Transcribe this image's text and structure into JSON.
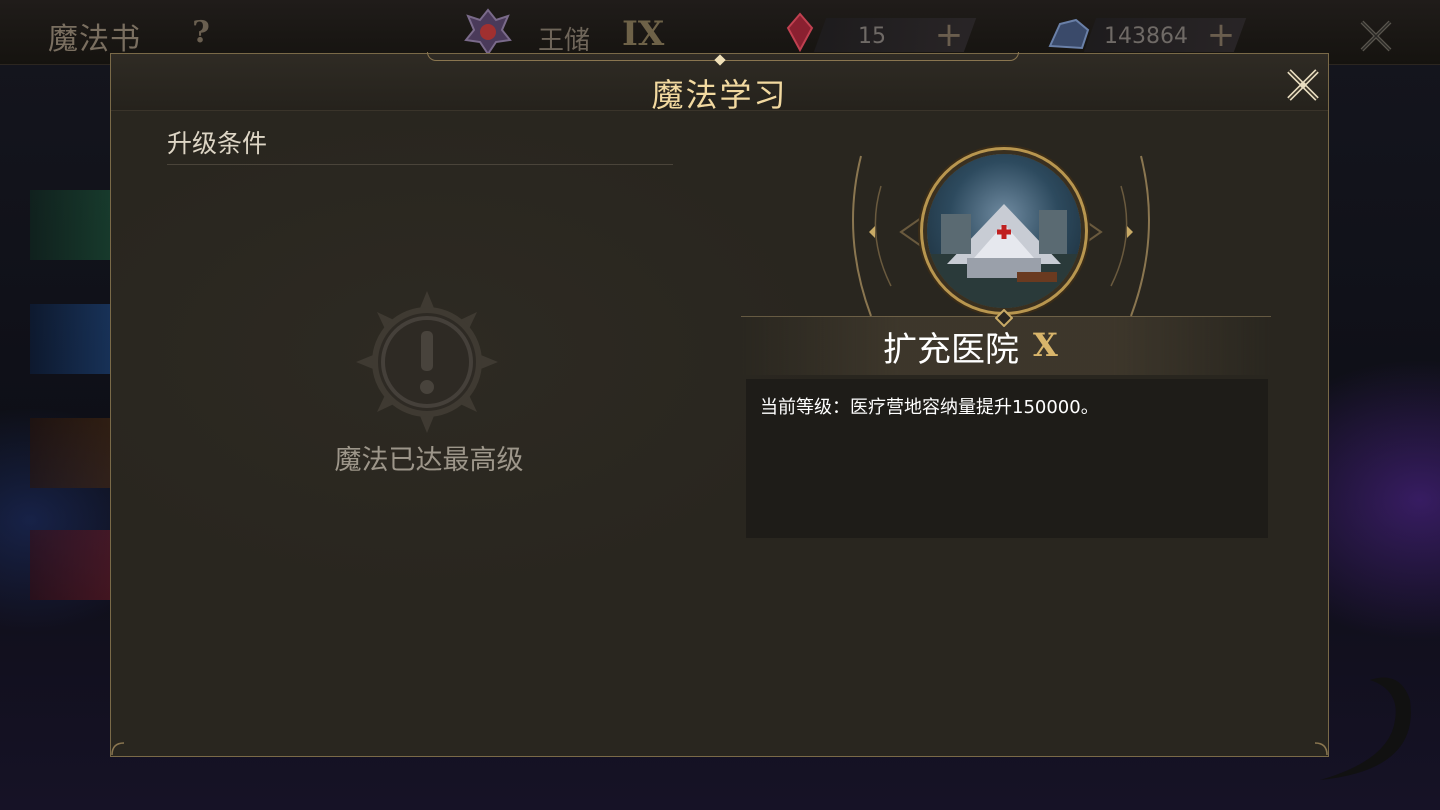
{
  "topbar": {
    "title": "魔法书",
    "help_icon": "question-icon",
    "rank_name": "王储",
    "rank_level": "IX",
    "resource_1_value": "15",
    "resource_2_value": "143864"
  },
  "dialog": {
    "title": "魔法学习",
    "section_heading": "升级条件",
    "max_level_text": "魔法已达最高级",
    "skill_name": "扩充医院",
    "skill_level": "X",
    "description": "当前等级：医疗营地容纳量提升150000。"
  },
  "colors": {
    "title_gold": "#f2d9a0",
    "level_gold": "#d9b56b",
    "panel_bg": "#29261f",
    "border_gold": "#7a6a48"
  },
  "icons": [
    "question-icon",
    "rank-emblem-icon",
    "gem-icon",
    "crystal-icon",
    "plus-icon",
    "close-icon",
    "exclamation-gear-icon",
    "hospital-tent-icon"
  ]
}
